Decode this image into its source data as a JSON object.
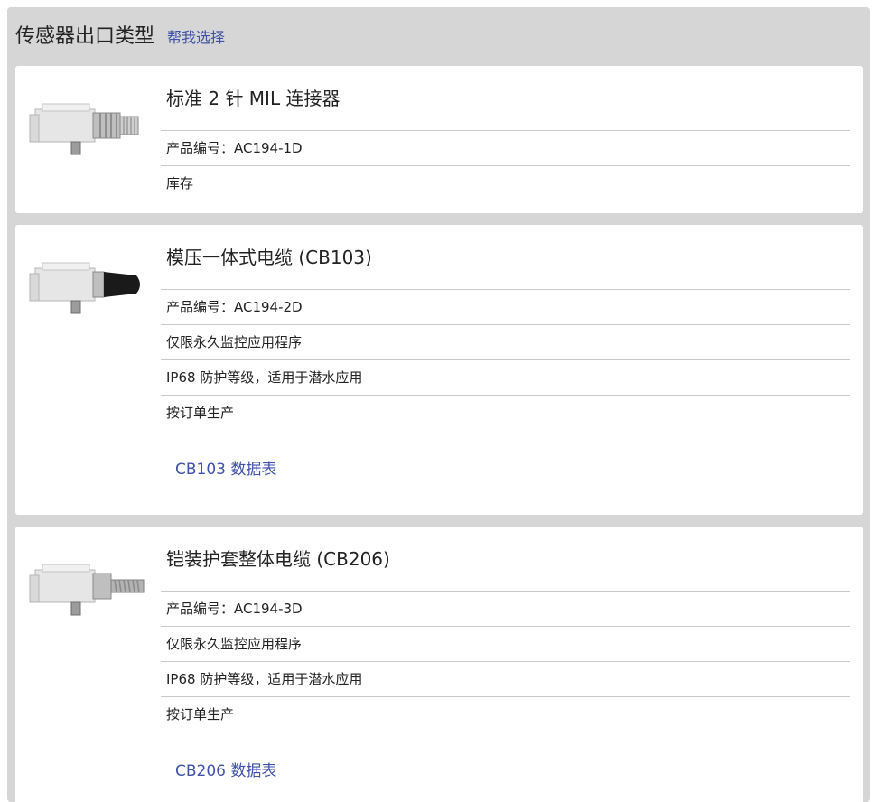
{
  "header": {
    "title": "传感器出口类型",
    "help_link": "帮我选择"
  },
  "products": [
    {
      "title": "标准 2 针 MIL 连接器",
      "part_number": "产品编号：AC194-1D",
      "notes": [
        "库存"
      ],
      "datasheet": null,
      "image": "mil-connector-sensor-image"
    },
    {
      "title": "模压一体式电缆 (CB103)",
      "part_number": "产品编号：AC194-2D",
      "notes": [
        "仅限永久监控应用程序",
        "IP68 防护等级，适用于潜水应用",
        "按订单生产"
      ],
      "datasheet": "CB103 数据表",
      "image": "molded-cable-sensor-image"
    },
    {
      "title": "铠装护套整体电缆 (CB206)",
      "part_number": "产品编号：AC194-3D",
      "notes": [
        "仅限永久监控应用程序",
        "IP68 防护等级，适用于潜水应用",
        "按订单生产"
      ],
      "datasheet": "CB206 数据表",
      "image": "armored-cable-sensor-image"
    }
  ]
}
